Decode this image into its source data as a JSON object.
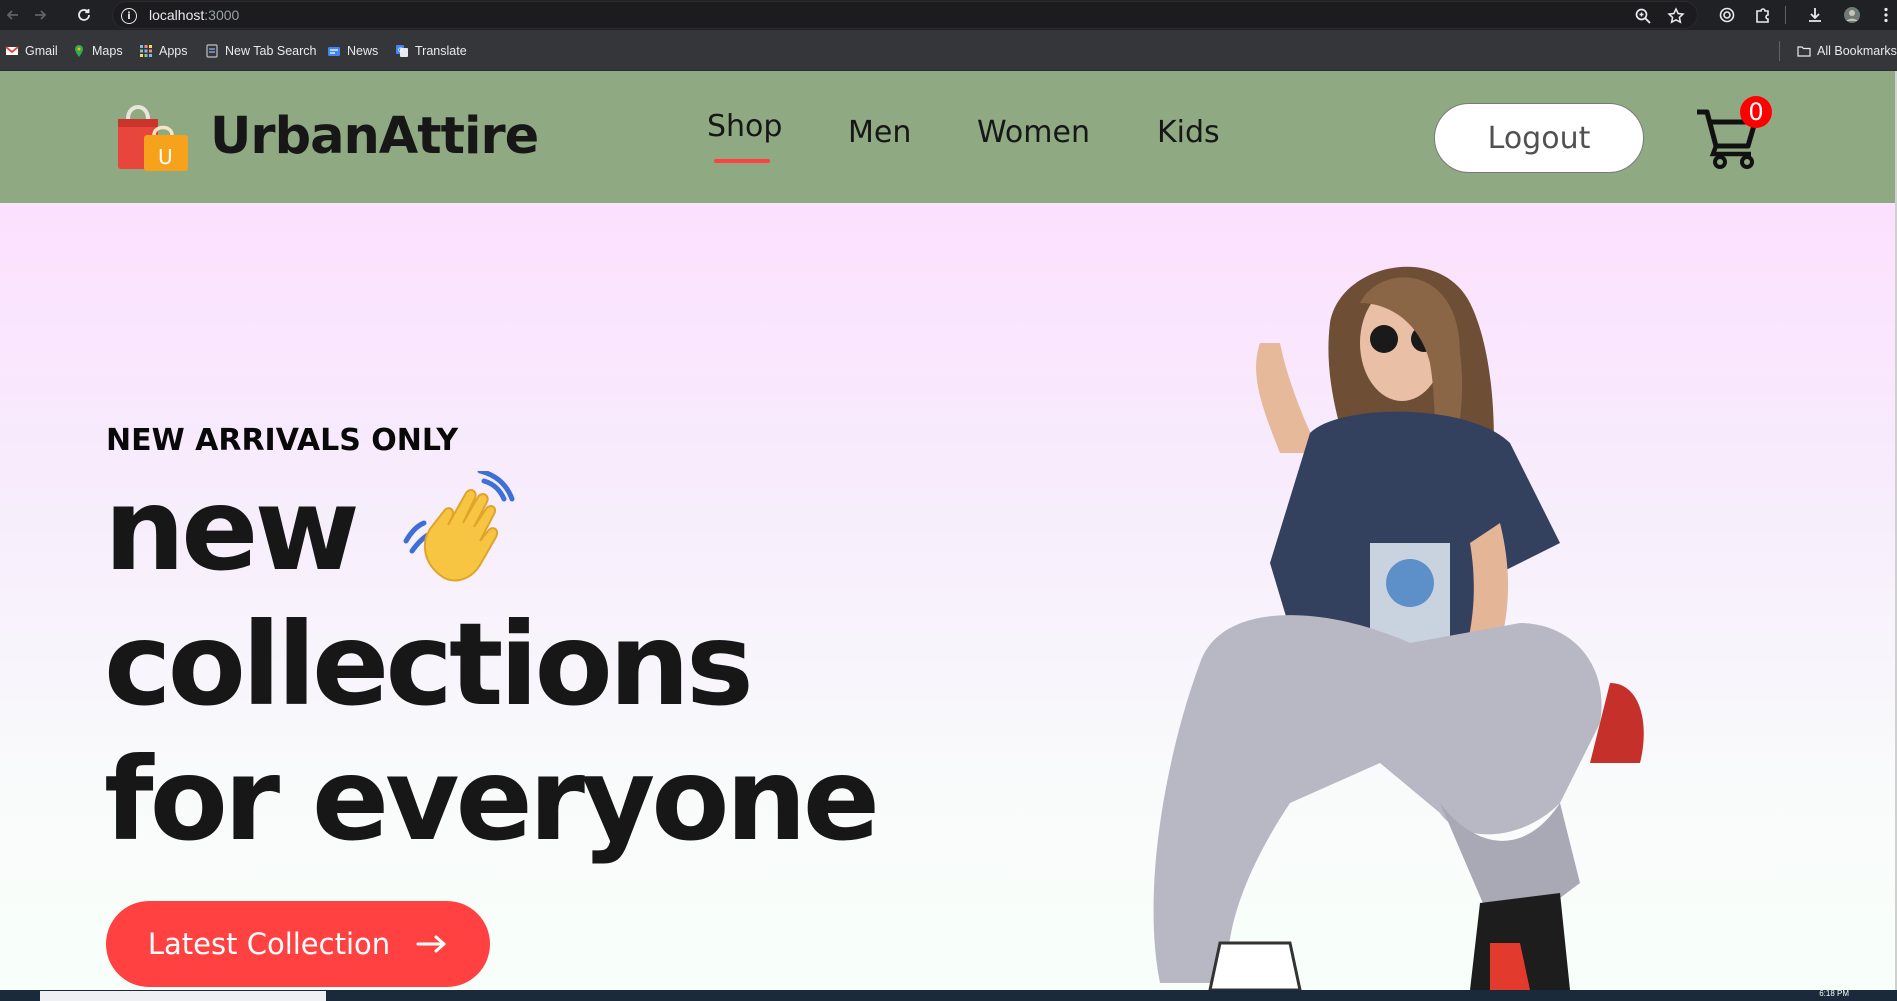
{
  "browser": {
    "url_host": "localhost",
    "url_port": ":3000",
    "bookmarks": [
      "Gmail",
      "Maps",
      "Apps",
      "New Tab Search",
      "News",
      "Translate"
    ],
    "all_bookmarks": "All Bookmarks",
    "icons": [
      "back-icon",
      "forward-icon",
      "reload-icon",
      "info-icon",
      "zoom-icon",
      "star-icon",
      "extension-icon",
      "puzzle-icon",
      "download-icon",
      "profile-icon",
      "kebab-menu-icon"
    ]
  },
  "header": {
    "brand": "UrbanAttire",
    "menu": [
      "Shop",
      "Men",
      "Women",
      "Kids"
    ],
    "active_menu": "Shop",
    "logout_label": "Logout",
    "cart_count": "0",
    "colors": {
      "background": "#8faa83",
      "accent": "#ff4141",
      "badge": "#ff0000"
    }
  },
  "hero": {
    "eyebrow": "NEW ARRIVALS ONLY",
    "line1": "new",
    "line2": "collections",
    "line3": "for everyone",
    "cta_label": "Latest Collection",
    "emoji": "waving-hand",
    "colors": {
      "gradient_top": "#fce0ff",
      "gradient_bottom": "#f8fffa",
      "cta": "#ff4141",
      "text": "#171717"
    }
  },
  "taskbar": {
    "clock": "6:18 PM"
  }
}
